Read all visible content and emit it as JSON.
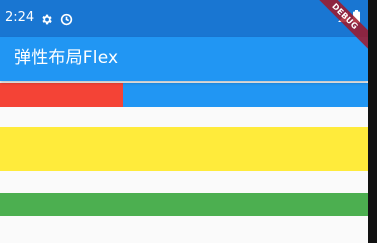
{
  "status_bar": {
    "time": "2:24",
    "icons": [
      "settings-gear-icon",
      "sync-icon",
      "wifi-icon",
      "battery-icon"
    ],
    "color": "#1976d2"
  },
  "app_bar": {
    "title": "弹性布局Flex",
    "color": "#2196f3"
  },
  "debug_banner": {
    "label": "DEBUG"
  },
  "flex_demo": {
    "row_1": {
      "items": [
        {
          "color": "#f44336",
          "flex": 1
        },
        {
          "color": "#2196f3",
          "flex": 2
        }
      ]
    },
    "row_2": {
      "items": [
        {
          "color": "#ffeb3b",
          "flex": 1
        }
      ]
    },
    "row_3": {
      "items": [
        {
          "color": "#4caf50",
          "flex": 1
        }
      ]
    }
  }
}
